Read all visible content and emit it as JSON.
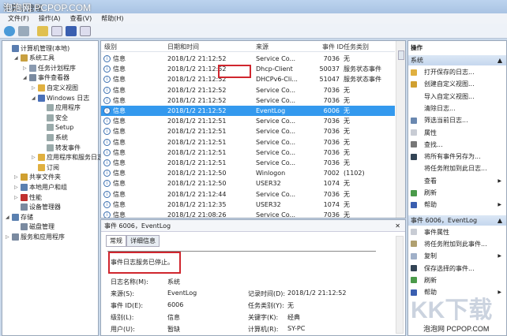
{
  "window": {
    "title": "计算机管理",
    "watermark": "泡泡网 PCPOP.COM"
  },
  "menu": [
    "文件(F)",
    "操作(A)",
    "查看(V)",
    "帮助(H)"
  ],
  "tree": [
    {
      "label": "计算机管理(本地)",
      "level": 0,
      "arrow": "",
      "color": "#5a7db0"
    },
    {
      "label": "系统工具",
      "level": 1,
      "arrow": "◢",
      "color": "#c8a040"
    },
    {
      "label": "任务计划程序",
      "level": 2,
      "arrow": "▷",
      "color": "#8a9ab0"
    },
    {
      "label": "事件查看器",
      "level": 2,
      "arrow": "◢",
      "color": "#7a8aa0"
    },
    {
      "label": "自定义视图",
      "level": 3,
      "arrow": "▷",
      "color": "#e0b040"
    },
    {
      "label": "Windows 日志",
      "level": 3,
      "arrow": "◢",
      "color": "#4a70b8"
    },
    {
      "label": "应用程序",
      "level": 4,
      "arrow": "",
      "color": "#9aa"
    },
    {
      "label": "安全",
      "level": 4,
      "arrow": "",
      "color": "#9aa"
    },
    {
      "label": "Setup",
      "level": 4,
      "arrow": "",
      "color": "#9aa"
    },
    {
      "label": "系统",
      "level": 4,
      "arrow": "",
      "color": "#9aa"
    },
    {
      "label": "转发事件",
      "level": 4,
      "arrow": "",
      "color": "#9aa"
    },
    {
      "label": "应用程序和服务日志",
      "level": 3,
      "arrow": "▷",
      "color": "#e0b040"
    },
    {
      "label": "订阅",
      "level": 3,
      "arrow": "",
      "color": "#e0b040"
    },
    {
      "label": "共享文件夹",
      "level": 1,
      "arrow": "▷",
      "color": "#d0a030"
    },
    {
      "label": "本地用户和组",
      "level": 1,
      "arrow": "▷",
      "color": "#5a80b0"
    },
    {
      "label": "性能",
      "level": 1,
      "arrow": "▷",
      "color": "#c03030"
    },
    {
      "label": "设备管理器",
      "level": 1,
      "arrow": "",
      "color": "#7a8aa0"
    },
    {
      "label": "存储",
      "level": 0,
      "arrow": "◢",
      "color": "#5a80b0"
    },
    {
      "label": "磁盘管理",
      "level": 1,
      "arrow": "",
      "color": "#7a8aa0"
    },
    {
      "label": "服务和应用程序",
      "level": 0,
      "arrow": "▷",
      "color": "#7a8aa0"
    }
  ],
  "list": {
    "columns": [
      "级别",
      "日期和时间",
      "来源",
      "事件 ID",
      "任务类别"
    ],
    "rows": [
      [
        "信息",
        "2018/1/2 21:12:52",
        "Service Co...",
        "7036",
        "无"
      ],
      [
        "信息",
        "2018/1/2 21:12:52",
        "Dhcp-Client",
        "50037",
        "服务状态事件"
      ],
      [
        "信息",
        "2018/1/2 21:12:52",
        "DHCPv6-Cli...",
        "51047",
        "服务状态事件"
      ],
      [
        "信息",
        "2018/1/2 21:12:52",
        "Service Co...",
        "7036",
        "无"
      ],
      [
        "信息",
        "2018/1/2 21:12:52",
        "Service Co...",
        "7036",
        "无"
      ],
      [
        "信息",
        "2018/1/2 21:12:52",
        "EventLog",
        "6006",
        "无"
      ],
      [
        "信息",
        "2018/1/2 21:12:51",
        "Service Co...",
        "7036",
        "无"
      ],
      [
        "信息",
        "2018/1/2 21:12:51",
        "Service Co...",
        "7036",
        "无"
      ],
      [
        "信息",
        "2018/1/2 21:12:51",
        "Service Co...",
        "7036",
        "无"
      ],
      [
        "信息",
        "2018/1/2 21:12:51",
        "Service Co...",
        "7036",
        "无"
      ],
      [
        "信息",
        "2018/1/2 21:12:51",
        "Service Co...",
        "7036",
        "无"
      ],
      [
        "信息",
        "2018/1/2 21:12:50",
        "Winlogon",
        "7002",
        "(1102)"
      ],
      [
        "信息",
        "2018/1/2 21:12:50",
        "USER32",
        "1074",
        "无"
      ],
      [
        "信息",
        "2018/1/2 21:12:44",
        "Service Co...",
        "7036",
        "无"
      ],
      [
        "信息",
        "2018/1/2 21:12:35",
        "USER32",
        "1074",
        "无"
      ],
      [
        "信息",
        "2018/1/2 21:08:26",
        "Service Co...",
        "7036",
        "无"
      ]
    ],
    "selected_index": 5
  },
  "detail": {
    "title": "事件 6006，EventLog",
    "close": "✕",
    "tabs": [
      "常规",
      "详细信息"
    ],
    "message": "事件日志服务已停止。",
    "fields": {
      "log_name_label": "日志名称(M):",
      "log_name": "系统",
      "source_label": "来源(S):",
      "source": "EventLog",
      "logged_label": "记录时间(D):",
      "logged": "2018/1/2 21:12:52",
      "event_id_label": "事件 ID(E):",
      "event_id": "6006",
      "task_label": "任务类别(Y):",
      "task": "无",
      "level_label": "级别(L):",
      "level": "信息",
      "keywords_label": "关键字(K):",
      "keywords": "经典",
      "user_label": "用户(U):",
      "user": "暂缺",
      "computer_label": "计算机(R):",
      "computer": "SY-PC"
    }
  },
  "actions": {
    "header": "操作",
    "sections": [
      {
        "title": "系统",
        "items": [
          {
            "label": "打开保存的日志...",
            "color": "#e0b040",
            "sub": ""
          },
          {
            "label": "创建自定义视图...",
            "color": "#d0a030",
            "sub": ""
          },
          {
            "label": "导入自定义视图...",
            "color": "",
            "sub": ""
          },
          {
            "label": "清除日志...",
            "color": "",
            "sub": ""
          },
          {
            "label": "筛选当前日志...",
            "color": "#6a88b0",
            "sub": ""
          },
          {
            "label": "属性",
            "color": "#c8ccd4",
            "sub": ""
          },
          {
            "label": "查找...",
            "color": "#777",
            "sub": ""
          },
          {
            "label": "将所有事件另存为...",
            "color": "#345",
            "sub": ""
          },
          {
            "label": "将任务附加到此日志...",
            "color": "",
            "sub": ""
          },
          {
            "label": "查看",
            "color": "",
            "sub": "▶"
          },
          {
            "label": "刷新",
            "color": "#4a9a4a",
            "sub": ""
          },
          {
            "label": "帮助",
            "color": "#3a5fb0",
            "sub": "▶"
          }
        ]
      },
      {
        "title": "事件 6006，EventLog",
        "items": [
          {
            "label": "事件属性",
            "color": "#c8ccd4",
            "sub": ""
          },
          {
            "label": "将任务附加到此事件...",
            "color": "#b0a070",
            "sub": ""
          },
          {
            "label": "复制",
            "color": "#a0b0c8",
            "sub": "▶"
          },
          {
            "label": "保存选择的事件...",
            "color": "#345",
            "sub": ""
          },
          {
            "label": "刷新",
            "color": "#4a9a4a",
            "sub": ""
          },
          {
            "label": "帮助",
            "color": "#3a5fb0",
            "sub": "▶"
          }
        ]
      }
    ],
    "collapse": "▲"
  },
  "watermark": {
    "kk": "KK下载",
    "site": "泡泡网 PCPOP.COM"
  }
}
